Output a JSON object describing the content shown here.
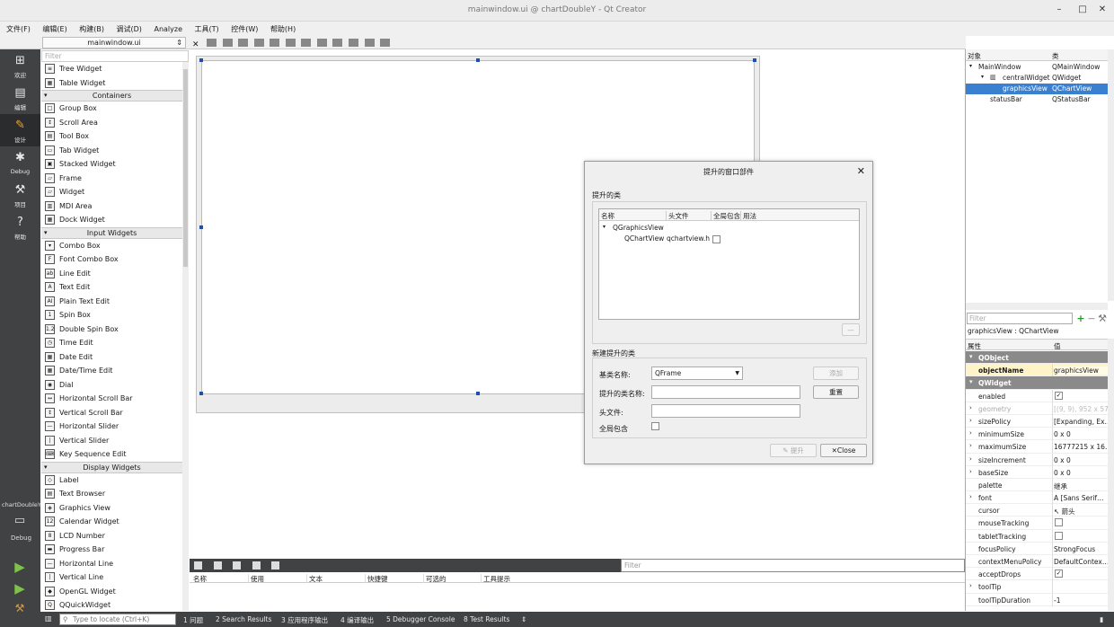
{
  "window": {
    "title": "mainwindow.ui @ chartDoubleY - Qt Creator",
    "minimize": "–",
    "maximize": "□",
    "close": "✕"
  },
  "menu": [
    "文件(F)",
    "编辑(E)",
    "构建(B)",
    "调试(D)",
    "Analyze",
    "工具(T)",
    "控件(W)",
    "帮助(H)"
  ],
  "modes": [
    {
      "label": "欢迎",
      "icon": "grid-icon"
    },
    {
      "label": "编辑",
      "icon": "document-icon"
    },
    {
      "label": "设计",
      "icon": "pencil-icon"
    },
    {
      "label": "Debug",
      "icon": "bug-icon"
    },
    {
      "label": "项目",
      "icon": "wrench-icon"
    },
    {
      "label": "帮助",
      "icon": "help-icon"
    }
  ],
  "kit": {
    "name": "chartDoubleY",
    "label": "Debug"
  },
  "open_file": "mainwindow.ui",
  "widget_filter_placeholder": "Filter",
  "widgetbox": [
    {
      "type": "item",
      "label": "Tree Widget",
      "ic": "≡"
    },
    {
      "type": "item",
      "label": "Table Widget",
      "ic": "▦"
    },
    {
      "type": "cat",
      "label": "Containers"
    },
    {
      "type": "item",
      "label": "Group Box",
      "ic": "□"
    },
    {
      "type": "item",
      "label": "Scroll Area",
      "ic": "↕"
    },
    {
      "type": "item",
      "label": "Tool Box",
      "ic": "▤"
    },
    {
      "type": "item",
      "label": "Tab Widget",
      "ic": "▭"
    },
    {
      "type": "item",
      "label": "Stacked Widget",
      "ic": "▣"
    },
    {
      "type": "item",
      "label": "Frame",
      "ic": "▱"
    },
    {
      "type": "item",
      "label": "Widget",
      "ic": "▱"
    },
    {
      "type": "item",
      "label": "MDI Area",
      "ic": "▥"
    },
    {
      "type": "item",
      "label": "Dock Widget",
      "ic": "▦"
    },
    {
      "type": "cat",
      "label": "Input Widgets"
    },
    {
      "type": "item",
      "label": "Combo Box",
      "ic": "▾"
    },
    {
      "type": "item",
      "label": "Font Combo Box",
      "ic": "F"
    },
    {
      "type": "item",
      "label": "Line Edit",
      "ic": "ab"
    },
    {
      "type": "item",
      "label": "Text Edit",
      "ic": "A"
    },
    {
      "type": "item",
      "label": "Plain Text Edit",
      "ic": "AI"
    },
    {
      "type": "item",
      "label": "Spin Box",
      "ic": "1"
    },
    {
      "type": "item",
      "label": "Double Spin Box",
      "ic": "1.2"
    },
    {
      "type": "item",
      "label": "Time Edit",
      "ic": "◷"
    },
    {
      "type": "item",
      "label": "Date Edit",
      "ic": "▦"
    },
    {
      "type": "item",
      "label": "Date/Time Edit",
      "ic": "▦"
    },
    {
      "type": "item",
      "label": "Dial",
      "ic": "◉"
    },
    {
      "type": "item",
      "label": "Horizontal Scroll Bar",
      "ic": "↔"
    },
    {
      "type": "item",
      "label": "Vertical Scroll Bar",
      "ic": "↕"
    },
    {
      "type": "item",
      "label": "Horizontal Slider",
      "ic": "—"
    },
    {
      "type": "item",
      "label": "Vertical Slider",
      "ic": "|"
    },
    {
      "type": "item",
      "label": "Key Sequence Edit",
      "ic": "⌨"
    },
    {
      "type": "cat",
      "label": "Display Widgets"
    },
    {
      "type": "item",
      "label": "Label",
      "ic": "◇"
    },
    {
      "type": "item",
      "label": "Text Browser",
      "ic": "▤"
    },
    {
      "type": "item",
      "label": "Graphics View",
      "ic": "◈"
    },
    {
      "type": "item",
      "label": "Calendar Widget",
      "ic": "12"
    },
    {
      "type": "item",
      "label": "LCD Number",
      "ic": "8"
    },
    {
      "type": "item",
      "label": "Progress Bar",
      "ic": "▬"
    },
    {
      "type": "item",
      "label": "Horizontal Line",
      "ic": "—"
    },
    {
      "type": "item",
      "label": "Vertical Line",
      "ic": "|"
    },
    {
      "type": "item",
      "label": "OpenGL Widget",
      "ic": "◆"
    },
    {
      "type": "item",
      "label": "QQuickWidget",
      "ic": "Q"
    }
  ],
  "dialog": {
    "title": "提升的窗口部件",
    "close": "✕",
    "promoted_group": "提升的类",
    "tree_headers": [
      "名称",
      "头文件",
      "全局包含",
      "用法"
    ],
    "tree_parent": "QGraphicsView",
    "tree_child_name": "QChartView",
    "tree_child_header": "qchartview.h",
    "new_group": "新建提升的类",
    "base_class_label": "基类名称:",
    "base_class_value": "QFrame",
    "promoted_class_label": "提升的类名称:",
    "header_file_label": "头文件:",
    "global_include_label": "全局包含",
    "add_button": "添加",
    "reset_button": "重置",
    "promote_button": "提升",
    "close_button": "Close"
  },
  "action_editor": {
    "filter_placeholder": "Filter",
    "headers": [
      "名称",
      "使用",
      "文本",
      "快捷键",
      "可选的",
      "工具提示"
    ]
  },
  "object_inspector": {
    "headers": [
      "对象",
      "类"
    ],
    "rows": [
      {
        "object": "MainWindow",
        "class": "QMainWindow"
      },
      {
        "object": "centralWidget",
        "class": "QWidget"
      },
      {
        "object": "graphicsView",
        "class": "QChartView"
      },
      {
        "object": "statusBar",
        "class": "QStatusBar"
      }
    ]
  },
  "property_editor": {
    "filter_placeholder": "Filter",
    "object_label": "graphicsView : QChartView",
    "headers": [
      "属性",
      "值"
    ],
    "rows": [
      {
        "kind": "cat",
        "name": "QObject",
        "value": ""
      },
      {
        "kind": "hl",
        "name": "objectName",
        "value": "graphicsView",
        "bold": true
      },
      {
        "kind": "cat",
        "name": "QWidget",
        "value": ""
      },
      {
        "kind": "prop",
        "name": "enabled",
        "value": "",
        "check": "✓"
      },
      {
        "kind": "prop",
        "name": "geometry",
        "value": "[(9, 9), 952 x 574]",
        "arrow": true,
        "muted": true
      },
      {
        "kind": "prop",
        "name": "sizePolicy",
        "value": "[Expanding, Ex…",
        "arrow": true
      },
      {
        "kind": "prop",
        "name": "minimumSize",
        "value": "0 x 0",
        "arrow": true
      },
      {
        "kind": "prop",
        "name": "maximumSize",
        "value": "16777215 x 16…",
        "arrow": true
      },
      {
        "kind": "prop",
        "name": "sizeIncrement",
        "value": "0 x 0",
        "arrow": true
      },
      {
        "kind": "prop",
        "name": "baseSize",
        "value": "0 x 0",
        "arrow": true
      },
      {
        "kind": "prop",
        "name": "palette",
        "value": "继承"
      },
      {
        "kind": "prop",
        "name": "font",
        "value": "A  [Sans Serif…",
        "arrow": true
      },
      {
        "kind": "prop",
        "name": "cursor",
        "value": "↖  箭头"
      },
      {
        "kind": "prop",
        "name": "mouseTracking",
        "value": "",
        "check": " "
      },
      {
        "kind": "prop",
        "name": "tabletTracking",
        "value": "",
        "check": " "
      },
      {
        "kind": "prop",
        "name": "focusPolicy",
        "value": "StrongFocus"
      },
      {
        "kind": "prop",
        "name": "contextMenuPolicy",
        "value": "DefaultContex…"
      },
      {
        "kind": "prop",
        "name": "acceptDrops",
        "value": "",
        "check": "✓"
      },
      {
        "kind": "prop",
        "name": "toolTip",
        "value": "",
        "arrow": true
      },
      {
        "kind": "prop",
        "name": "toolTipDuration",
        "value": "-1"
      }
    ]
  },
  "statusbar": {
    "locate_placeholder": "Type to locate (Ctrl+K)",
    "panes": [
      "1 问题",
      "2 Search Results",
      "3 应用程序输出",
      "4 编译输出",
      "5 Debugger Console",
      "8 Test Results"
    ]
  }
}
